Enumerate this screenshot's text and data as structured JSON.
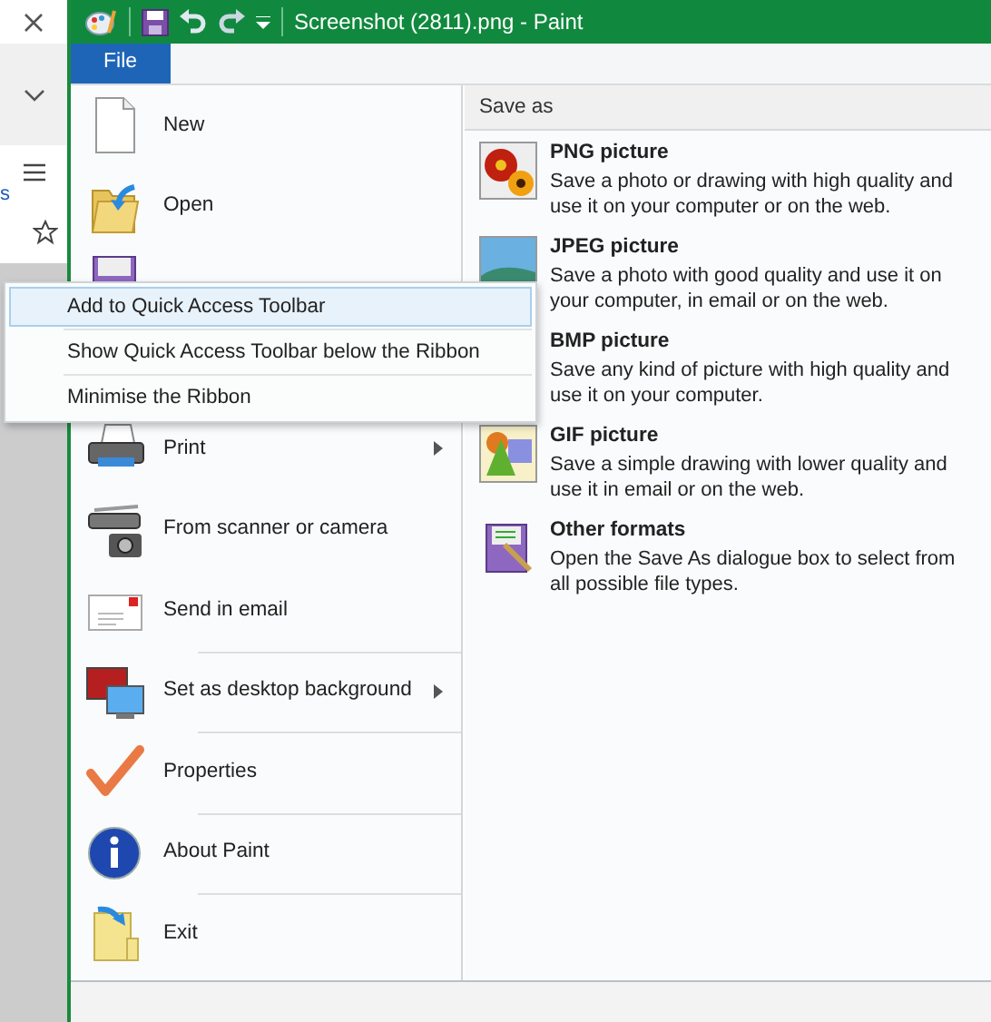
{
  "browser_strip": {
    "partial_text": "s"
  },
  "window": {
    "title": "Screenshot (2811).png - Paint"
  },
  "tabs": [
    {
      "label": "File",
      "selected": true
    }
  ],
  "file_menu": {
    "items": [
      {
        "kind": "new",
        "label": "New",
        "submenu": false
      },
      {
        "kind": "open",
        "label": "Open",
        "submenu": false
      },
      {
        "kind": "save"
      },
      {
        "kind": "saveas"
      },
      {
        "kind": "print",
        "label": "Print",
        "submenu": true
      },
      {
        "kind": "scanner",
        "label": "From scanner or camera",
        "submenu": false
      },
      {
        "kind": "email",
        "label": "Send in email",
        "submenu": false
      },
      {
        "kind": "desktop",
        "label": "Set as desktop background",
        "submenu": true
      },
      {
        "kind": "properties",
        "label": "Properties",
        "submenu": false
      },
      {
        "kind": "about",
        "label": "About Paint",
        "submenu": false
      },
      {
        "kind": "exit",
        "label": "Exit",
        "submenu": false
      }
    ]
  },
  "save_as": {
    "heading": "Save as",
    "options": [
      {
        "kind": "png",
        "title": "PNG picture",
        "description": "Save a photo or drawing with high quality and use it on your computer or on the web."
      },
      {
        "kind": "jpeg",
        "title": "JPEG picture",
        "description": "Save a photo with good quality and use it on your computer, in email or on the web."
      },
      {
        "kind": "bmp",
        "title": "BMP picture",
        "description": "Save any kind of picture with high quality and use it on your computer."
      },
      {
        "kind": "gif",
        "title": "GIF picture",
        "description": "Save a simple drawing with lower quality and use it in email or on the web."
      },
      {
        "kind": "other",
        "title": "Other formats",
        "description": "Open the Save As dialogue box to select from all possible file types."
      }
    ]
  },
  "context_menu": {
    "items": [
      {
        "label": "Add to Quick Access Toolbar",
        "selected": true
      },
      {
        "label": "Show Quick Access Toolbar below the Ribbon",
        "selected": false
      },
      {
        "label": "Minimise the Ribbon",
        "selected": false
      }
    ]
  }
}
